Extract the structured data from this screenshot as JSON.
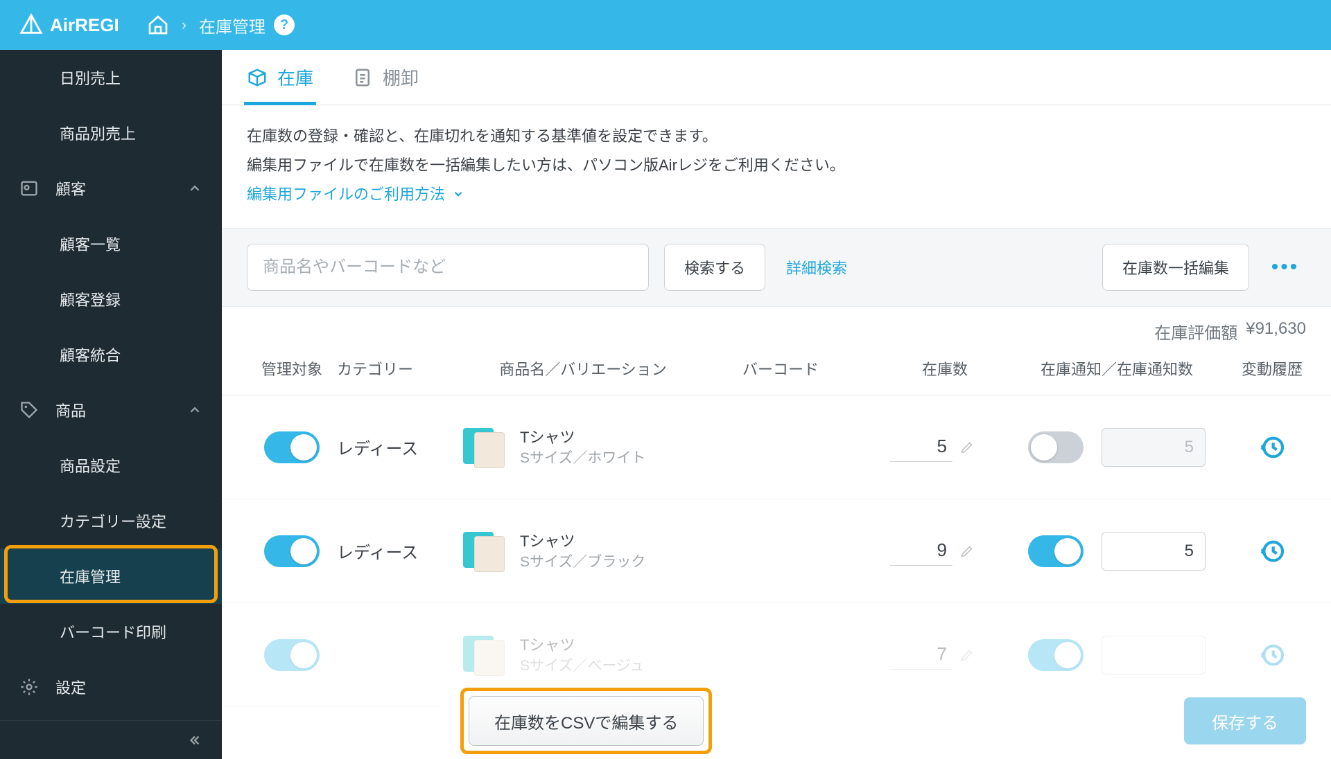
{
  "header": {
    "app_name": "AirREGI",
    "breadcrumb": "在庫管理"
  },
  "sidebar": {
    "items": [
      {
        "label": "日別売上"
      },
      {
        "label": "商品別売上"
      },
      {
        "label": "顧客",
        "icon": "contact"
      },
      {
        "label": "顧客一覧"
      },
      {
        "label": "顧客登録"
      },
      {
        "label": "顧客統合"
      },
      {
        "label": "商品",
        "icon": "tag"
      },
      {
        "label": "商品設定"
      },
      {
        "label": "カテゴリー設定"
      },
      {
        "label": "在庫管理"
      },
      {
        "label": "バーコード印刷"
      },
      {
        "label": "設定",
        "icon": "gear"
      }
    ]
  },
  "tabs": {
    "stock": "在庫",
    "stocktaking": "棚卸"
  },
  "intro": {
    "line1": "在庫数の登録・確認と、在庫切れを通知する基準値を設定できます。",
    "line2": "編集用ファイルで在庫数を一括編集したい方は、パソコン版Airレジをご利用ください。",
    "link": "編集用ファイルのご利用方法"
  },
  "search": {
    "placeholder": "商品名やバーコードなど",
    "button": "検索する",
    "advanced": "詳細検索",
    "bulk_edit": "在庫数一括編集"
  },
  "valuation": {
    "label": "在庫評価額",
    "value": "¥91,630"
  },
  "columns": {
    "target": "管理対象",
    "category": "カテゴリー",
    "name": "商品名／バリエーション",
    "barcode": "バーコード",
    "stock": "在庫数",
    "notify": "在庫通知／在庫通知数",
    "history": "変動履歴"
  },
  "rows": [
    {
      "enabled": true,
      "category": "レディース",
      "name": "Tシャツ",
      "variation": "Sサイズ／ホワイト",
      "stock": "5",
      "notify_on": false,
      "notify_value": "5"
    },
    {
      "enabled": true,
      "category": "レディース",
      "name": "Tシャツ",
      "variation": "Sサイズ／ブラック",
      "stock": "9",
      "notify_on": true,
      "notify_value": "5"
    },
    {
      "enabled": true,
      "category": "",
      "name": "Tシャツ",
      "variation": "Sサイズ／ベージュ",
      "stock": "7",
      "notify_on": true,
      "notify_value": ""
    }
  ],
  "footer": {
    "csv_button": "在庫数をCSVで編集する",
    "save_button": "保存する"
  }
}
